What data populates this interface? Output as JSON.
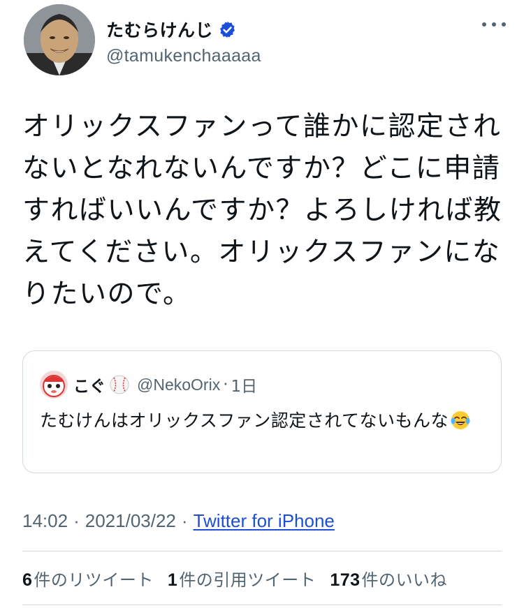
{
  "author": {
    "display_name": "たむらけんじ",
    "handle": "@tamukenchaaaaa",
    "verified_icon": "verified-badge-icon"
  },
  "tweet": {
    "text": "オリックスファンって誰かに認定されないとなれないんですか？どこに申請すればいいんですか？よろしければ教えてください。オリックスファンになりたいので。"
  },
  "quoted": {
    "name": "こぐ",
    "name_icon": "baseball-icon",
    "handle": "@NekoOrix",
    "separator": "·",
    "time": "1日",
    "text": "たむけんはオリックスファン認定されてないもんな",
    "emoji": "laughing-tears-icon"
  },
  "meta": {
    "time": "14:02",
    "sep1": "·",
    "date": "2021/03/22",
    "sep2": "·",
    "source": "Twitter for iPhone"
  },
  "stats": {
    "retweets_count": "6",
    "retweets_label": "件のリツイート",
    "quotes_count": "1",
    "quotes_label": "件の引用ツイート",
    "likes_count": "173",
    "likes_label": "件のいいね"
  },
  "colors": {
    "text": "#0f1419",
    "secondary": "#536471",
    "link": "#1d4ed8",
    "verified": "#1d4ed8",
    "border": "#cfd9de"
  }
}
